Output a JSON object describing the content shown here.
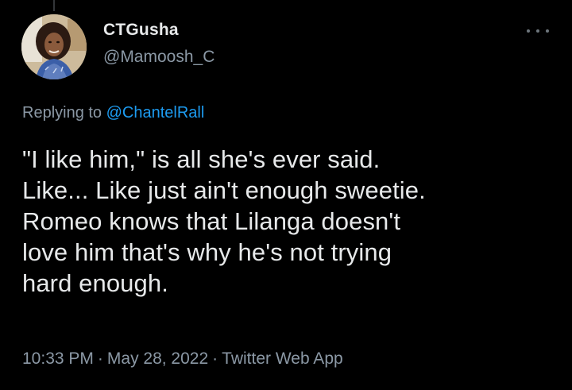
{
  "tweet": {
    "display_name": "CTGusha",
    "handle": "@Mamoosh_C",
    "replying_prefix": "Replying to",
    "replying_to": "@ChantelRall",
    "text_lines": [
      "\"I like him,\" is all she's ever said.",
      "Like... Like just ain't enough sweetie.",
      "Romeo knows that Lilanga doesn't",
      "love him that's why he's not trying",
      "hard enough."
    ],
    "time": "10:33 PM",
    "date": "May 28, 2022",
    "source": "Twitter Web App",
    "separator": "·"
  },
  "icons": {
    "more": "more-horizontal-icon",
    "avatar": "profile-photo"
  },
  "colors": {
    "background": "#000000",
    "text": "#e7e9ea",
    "muted": "#8b98a5",
    "link": "#1d9bf0"
  }
}
